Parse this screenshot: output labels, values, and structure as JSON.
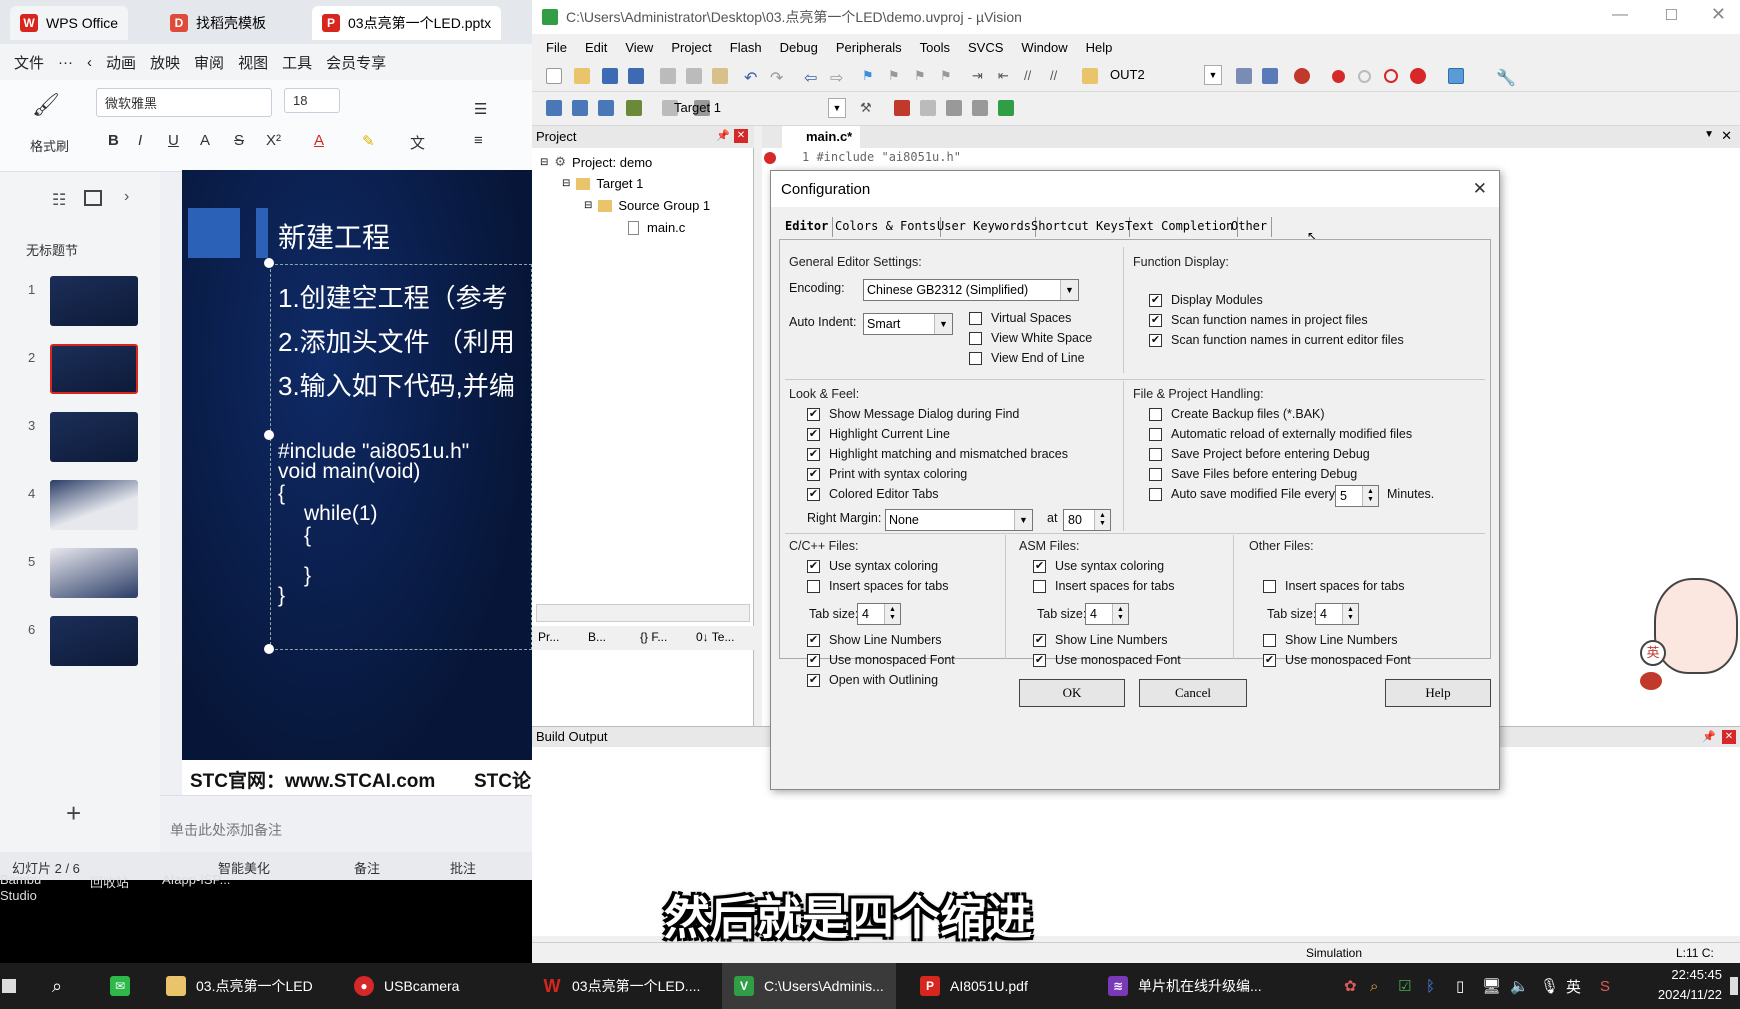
{
  "wps": {
    "tabs": [
      "WPS Office",
      "找稻壳模板",
      "03点亮第一个LED.pptx"
    ],
    "menu": [
      "文件",
      "···",
      "动画",
      "放映",
      "审阅",
      "视图",
      "工具",
      "会员专享"
    ],
    "ribbon": {
      "format_painter": "格式刷",
      "font_name": "微软雅黑",
      "font_size": "18"
    },
    "section": "无标题节",
    "slide_numbers": [
      "1",
      "2",
      "3",
      "4",
      "5",
      "6"
    ],
    "slide": {
      "title": "新建工程",
      "items": [
        "1.创建空工程（参考",
        "2.添加头文件 （利用",
        "3.输入如下代码,并编"
      ],
      "code": [
        "#include \"ai8051u.h\"",
        "void main(void)",
        "{",
        "while(1)",
        "{",
        "}",
        "}"
      ],
      "footer_left": "STC官网：www.STCAI.com",
      "footer_right": "STC论"
    },
    "notes_placeholder": "单击此处添加备注",
    "status": {
      "slide_count": "幻灯片 2 / 6",
      "beautify": "智能美化",
      "notes": "备注",
      "comments": "批注"
    },
    "desktop_labels": [
      "Bambu Studio",
      "回收站",
      "AIapp-ISP..."
    ]
  },
  "uvision": {
    "title": "C:\\Users\\Administrator\\Desktop\\03.点亮第一个LED\\demo.uvproj - µVision",
    "menu": [
      "File",
      "Edit",
      "View",
      "Project",
      "Flash",
      "Debug",
      "Peripherals",
      "Tools",
      "SVCS",
      "Window",
      "Help"
    ],
    "toolbar_out": "OUT2",
    "target_select": "Target 1",
    "project_panel": {
      "header": "Project",
      "tree": [
        "Project: demo",
        "Target 1",
        "Source Group 1",
        "main.c"
      ],
      "bottom_tabs": [
        "Pr...",
        "B...",
        "{} F...",
        "0↓ Te..."
      ]
    },
    "editor_tab": "main.c*",
    "editor_line": "1 #include \"ai8051u.h\"",
    "build_output": "Build Output",
    "status": {
      "mode": "Simulation",
      "pos": "L:11 C:"
    }
  },
  "dialog": {
    "title": "Configuration",
    "tabs": [
      "Editor",
      "Colors & Fonts",
      "User Keywords",
      "Shortcut Keys",
      "Text Completion",
      "Other"
    ],
    "general": {
      "label": "General Editor Settings:",
      "encoding_label": "Encoding:",
      "encoding": "Chinese GB2312 (Simplified)",
      "auto_indent_label": "Auto Indent:",
      "auto_indent": "Smart",
      "virtual_spaces": "Virtual Spaces",
      "view_white_space": "View White Space",
      "view_end_of_line": "View End of Line"
    },
    "function_display": {
      "label": "Function Display:",
      "display_modules": "Display Modules",
      "scan_project": "Scan function names in project files",
      "scan_editor": "Scan function names in current editor files"
    },
    "look_feel": {
      "label": "Look & Feel:",
      "items": [
        "Show Message Dialog during Find",
        "Highlight Current Line",
        "Highlight matching and mismatched braces",
        "Print with syntax coloring",
        "Colored Editor Tabs"
      ],
      "right_margin_label": "Right Margin:",
      "right_margin": "None",
      "at_label": "at",
      "at_value": "80"
    },
    "file_handling": {
      "label": "File & Project Handling:",
      "items": [
        "Create Backup files (*.BAK)",
        "Automatic reload of externally modified files",
        "Save Project before entering Debug",
        "Save Files before entering Debug",
        "Auto save modified File every"
      ],
      "autosave_value": "5",
      "minutes": "Minutes."
    },
    "c_files": {
      "label": "C/C++ Files:",
      "syntax": "Use syntax coloring",
      "spaces": "Insert spaces for tabs",
      "tab_label": "Tab size:",
      "tab_size": "4",
      "line_numbers": "Show Line Numbers",
      "mono": "Use monospaced Font",
      "outlining": "Open with Outlining"
    },
    "asm_files": {
      "label": "ASM Files:",
      "syntax": "Use syntax coloring",
      "spaces": "Insert spaces for tabs",
      "tab_label": "Tab size:",
      "tab_size": "4",
      "line_numbers": "Show Line Numbers",
      "mono": "Use monospaced Font"
    },
    "other_files": {
      "label": "Other Files:",
      "spaces": "Insert spaces for tabs",
      "tab_label": "Tab size:",
      "tab_size": "4",
      "line_numbers": "Show Line Numbers",
      "mono": "Use monospaced Font"
    },
    "buttons": {
      "ok": "OK",
      "cancel": "Cancel",
      "help": "Help"
    }
  },
  "subtitle": "然后就是四个缩进",
  "taskbar": {
    "items": [
      "03.点亮第一个LED",
      "USBcamera",
      "03点亮第一个LED....",
      "C:\\Users\\Adminis...",
      "AI8051U.pdf",
      "单片机在线升级编..."
    ],
    "ime": "英",
    "time": "22:45:45",
    "date": "2024/11/22"
  },
  "colors": {
    "wps_red": "#d7261e",
    "slide_bg": "#0c2156",
    "uv_green": "#2f9e44",
    "taskbar": "#1c1c1c"
  }
}
